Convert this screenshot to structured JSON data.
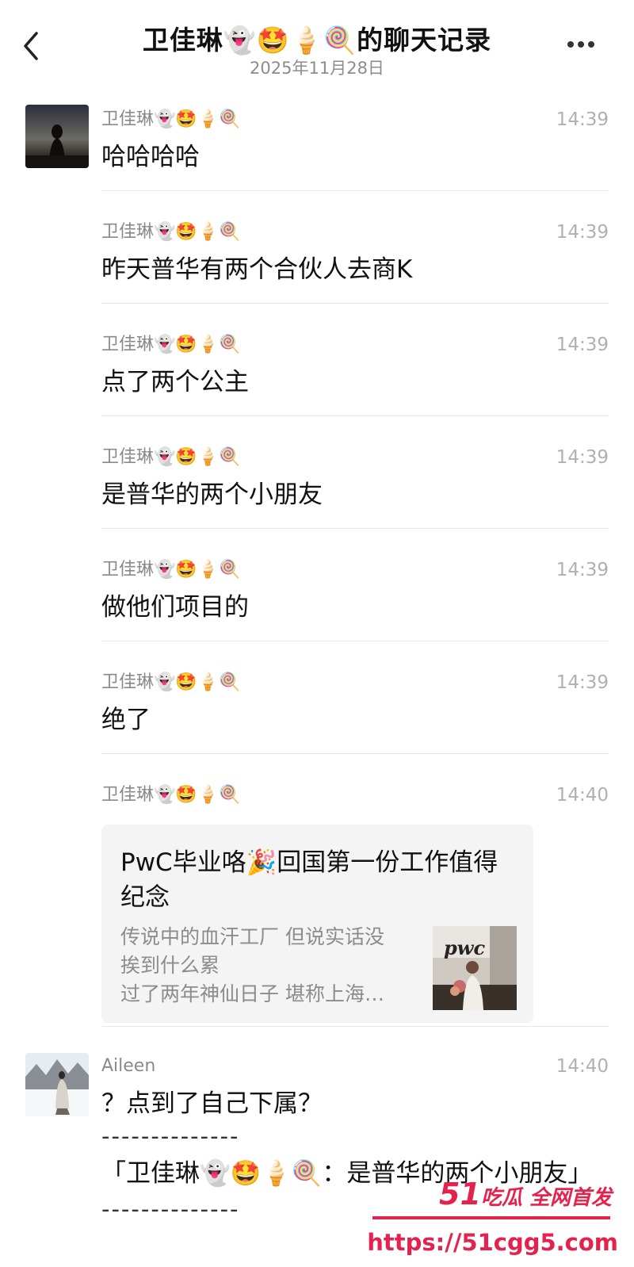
{
  "header": {
    "title": "卫佳琳👻🤩🍦🍭的聊天记录",
    "date": "2025年11月28日"
  },
  "messages": [
    {
      "sender": "卫佳琳👻🤩🍦🍭",
      "time": "14:39",
      "text": "哈哈哈哈"
    },
    {
      "sender": "卫佳琳👻🤩🍦🍭",
      "time": "14:39",
      "text": "昨天普华有两个合伙人去商K"
    },
    {
      "sender": "卫佳琳👻🤩🍦🍭",
      "time": "14:39",
      "text": "点了两个公主"
    },
    {
      "sender": "卫佳琳👻🤩🍦🍭",
      "time": "14:39",
      "text": "是普华的两个小朋友"
    },
    {
      "sender": "卫佳琳👻🤩🍦🍭",
      "time": "14:39",
      "text": "做他们项目的"
    },
    {
      "sender": "卫佳琳👻🤩🍦🍭",
      "time": "14:39",
      "text": "绝了"
    }
  ],
  "card_message": {
    "sender": "卫佳琳👻🤩🍦🍭",
    "time": "14:40",
    "title": "PwC毕业咯🎉回国第一份工作值得纪念",
    "desc_line1": "传说中的血汗工厂 但说实话没",
    "desc_line2": "挨到什么累",
    "desc_line3": "过了两年神仙日子 堪称上海…",
    "thumb_text": "pwc"
  },
  "reply_message": {
    "sender": "Aileen",
    "time": "14:40",
    "text": "？点到了自己下属？",
    "separator": "--------------",
    "quote": "「卫佳琳👻🤩🍦🍭：是普华的两个小朋友」",
    "separator_bottom": "--------------"
  },
  "watermark": {
    "brand_num": "51",
    "brand_text": "吃瓜 全网首发",
    "url": "https://51cgg5.com"
  },
  "colors": {
    "watermark": "#e5224e",
    "meta_gray": "#8c8c8c"
  }
}
